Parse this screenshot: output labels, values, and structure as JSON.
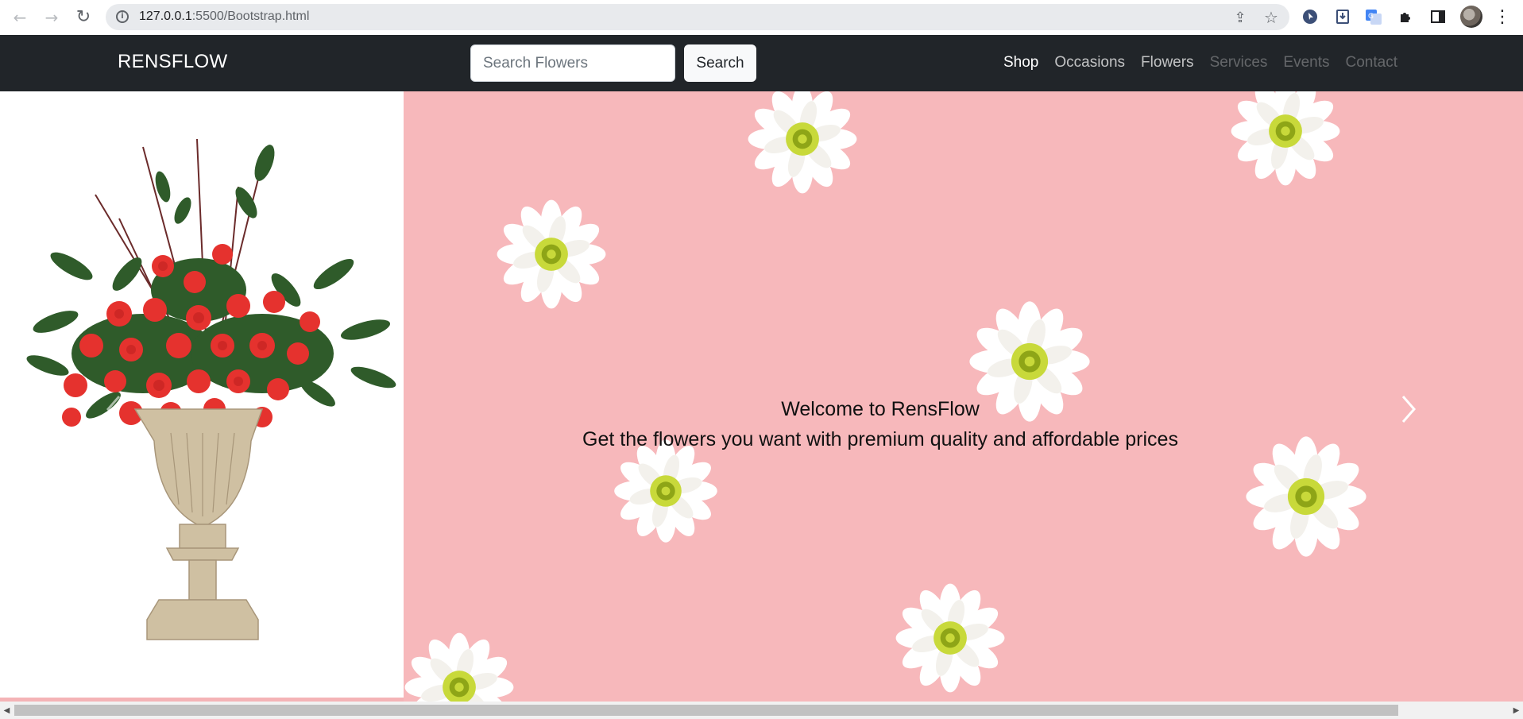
{
  "browser": {
    "url_host": "127.0.0.1",
    "url_rest": ":5500/Bootstrap.html",
    "back_icon": "←",
    "forward_icon": "→",
    "reload_icon": "↻",
    "share_icon": "⇪",
    "star_icon": "☆",
    "menu_icon": "⋮"
  },
  "navbar": {
    "brand": "RENSFLOW",
    "search_placeholder": "Search Flowers",
    "search_button": "Search",
    "links": [
      "Shop",
      "Occasions",
      "Flowers",
      "Services",
      "Events",
      "Contact"
    ]
  },
  "carousel": {
    "caption_title": "Welcome to RensFlow",
    "caption_text": "Get the flowers you want with premium quality and affordable prices"
  },
  "colors": {
    "navbar_bg": "#212529",
    "slide_pink": "#f7b8bb"
  }
}
